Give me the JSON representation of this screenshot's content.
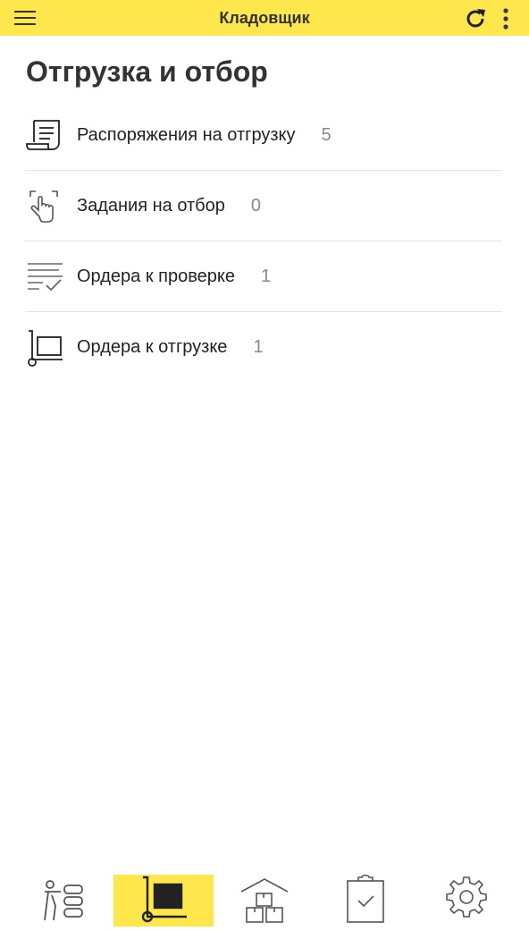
{
  "header": {
    "title": "Кладовщик",
    "icons": {
      "menu": "hamburger-menu-icon",
      "refresh": "refresh-icon",
      "more": "more-vertical-icon"
    }
  },
  "page": {
    "title": "Отгрузка и отбор"
  },
  "items": [
    {
      "label": "Распоряжения на отгрузку",
      "count": "5",
      "icon": "document-scroll-icon"
    },
    {
      "label": "Задания на отбор",
      "count": "0",
      "icon": "hand-tap-icon"
    },
    {
      "label": "Ордера к проверке",
      "count": "1",
      "icon": "checklist-icon"
    },
    {
      "label": "Ордера к отгрузке",
      "count": "1",
      "icon": "hand-truck-icon"
    }
  ],
  "bottom_nav": {
    "tabs": [
      {
        "name": "worker-tasks-icon",
        "active": false
      },
      {
        "name": "hand-truck-icon",
        "active": true
      },
      {
        "name": "warehouse-boxes-icon",
        "active": false
      },
      {
        "name": "clipboard-check-icon",
        "active": false
      },
      {
        "name": "gear-icon",
        "active": false
      }
    ]
  },
  "colors": {
    "accent": "#fde74c",
    "text": "#222222",
    "count": "#888888",
    "divider": "#e4e4e4"
  }
}
